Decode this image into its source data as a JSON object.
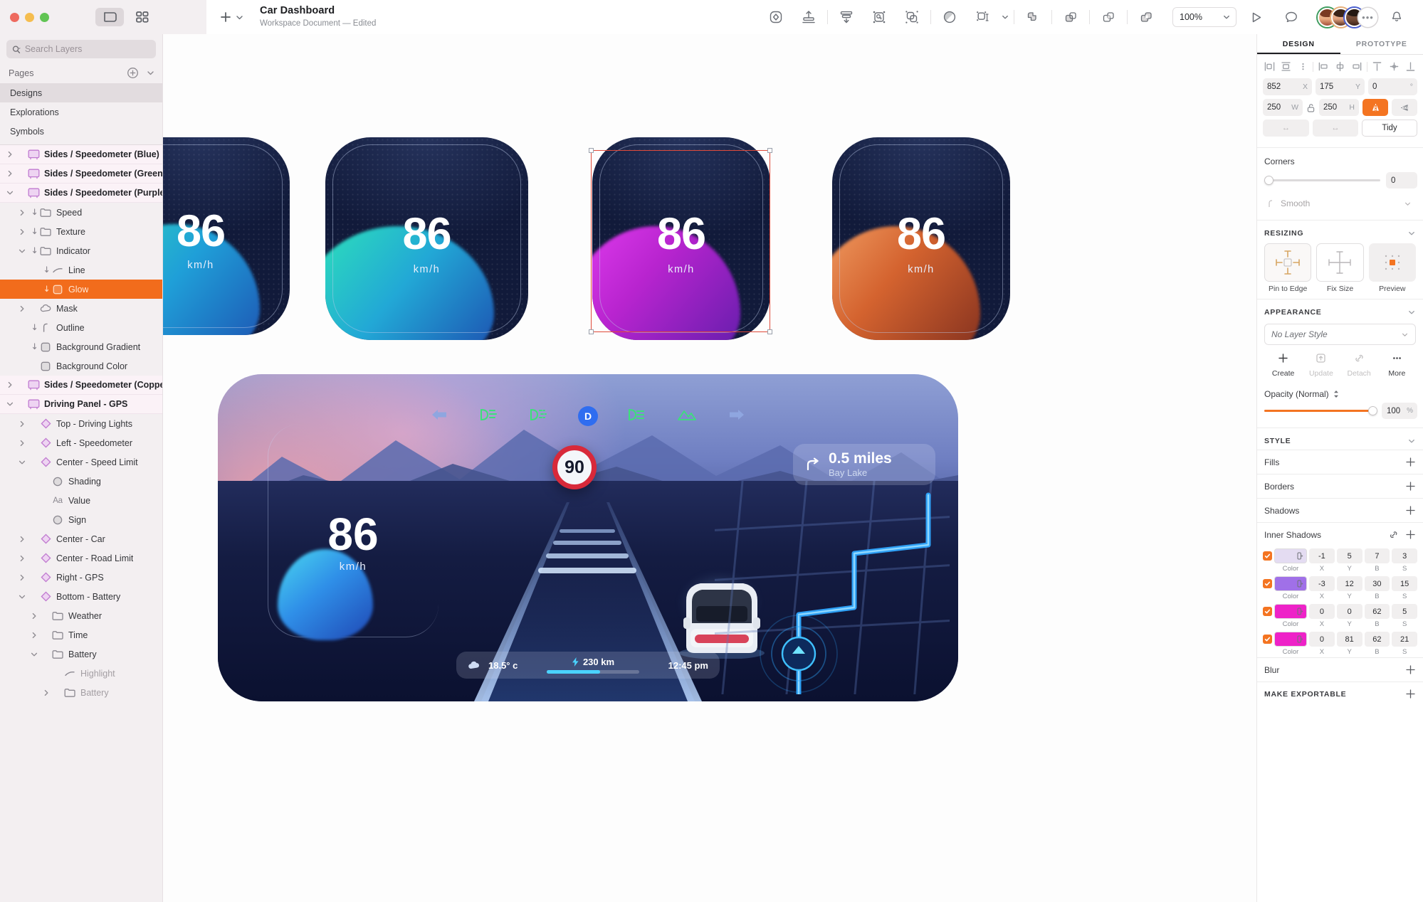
{
  "window": {
    "traffic_lights": [
      "close",
      "minimize",
      "maximize"
    ],
    "view_toggle_icons": [
      "canvas-view-icon",
      "grid-view-icon"
    ]
  },
  "toolbar": {
    "add_label": "+",
    "document_title": "Car Dashboard",
    "document_subtitle": "Workspace Document — Edited",
    "tools": [
      {
        "name": "component-icon",
        "label": "Component"
      },
      {
        "name": "align-vertical-icon",
        "label": "Align Vertical"
      },
      {
        "name": "distribute-icon",
        "label": "Distribute"
      },
      {
        "name": "group-icon",
        "label": "Group"
      },
      {
        "name": "ungroup-icon",
        "label": "Ungroup"
      },
      {
        "name": "mask-icon",
        "label": "Mask"
      },
      {
        "name": "scale-icon",
        "label": "Scale"
      },
      {
        "name": "boolean-union-icon",
        "label": "Union"
      },
      {
        "name": "boolean-subtract-icon",
        "label": "Subtract"
      },
      {
        "name": "boolean-intersect-icon",
        "label": "Intersect"
      },
      {
        "name": "boolean-difference-icon",
        "label": "Difference"
      }
    ],
    "zoom_value": "100%",
    "play_icon": "play-icon",
    "comment_icon": "comment-icon",
    "avatar_more": "•••",
    "bell_icon": "bell-icon"
  },
  "sidebar": {
    "search_placeholder": "Search Layers",
    "search_value": "",
    "pages_label": "Pages",
    "pages": [
      {
        "label": "Designs",
        "selected": true
      },
      {
        "label": "Explorations",
        "selected": false
      },
      {
        "label": "Symbols",
        "selected": false
      }
    ],
    "layers": [
      {
        "label": "Sides / Speedometer (Blue)",
        "kind": "artboard",
        "indent": 0,
        "disclosure": "collapsed",
        "selected": false
      },
      {
        "label": "Sides / Speedometer (Green)",
        "kind": "artboard",
        "indent": 0,
        "disclosure": "collapsed",
        "selected": false
      },
      {
        "label": "Sides / Speedometer (Purple)",
        "kind": "artboard",
        "indent": 0,
        "disclosure": "expanded",
        "selected": false
      },
      {
        "label": "Speed",
        "kind": "folder",
        "indent": 1,
        "disclosure": "collapsed",
        "mask": true,
        "selected": false
      },
      {
        "label": "Texture",
        "kind": "folder",
        "indent": 1,
        "disclosure": "collapsed",
        "mask": true,
        "selected": false
      },
      {
        "label": "Indicator",
        "kind": "folder",
        "indent": 1,
        "disclosure": "expanded",
        "mask": true,
        "selected": false
      },
      {
        "label": "Line",
        "kind": "line",
        "indent": 2,
        "disclosure": "none",
        "mask": true,
        "selected": false
      },
      {
        "label": "Glow",
        "kind": "shape",
        "indent": 2,
        "disclosure": "none",
        "mask": true,
        "selected": true
      },
      {
        "label": "Mask",
        "kind": "cloud",
        "indent": 1,
        "disclosure": "collapsed",
        "selected": false
      },
      {
        "label": "Outline",
        "kind": "outline",
        "indent": 1,
        "disclosure": "none",
        "mask": true,
        "selected": false
      },
      {
        "label": "Background Gradient",
        "kind": "shape",
        "indent": 1,
        "disclosure": "none",
        "mask": true,
        "selected": false
      },
      {
        "label": "Background Color",
        "kind": "shape",
        "indent": 1,
        "disclosure": "none",
        "selected": false
      },
      {
        "label": "Sides / Speedometer (Copper)",
        "kind": "artboard",
        "indent": 0,
        "disclosure": "collapsed",
        "selected": false
      },
      {
        "label": "Driving Panel - GPS",
        "kind": "artboard",
        "indent": 0,
        "disclosure": "expanded",
        "selected": false
      },
      {
        "label": "Top - Driving Lights",
        "kind": "symbol",
        "indent": 1,
        "disclosure": "collapsed",
        "selected": false
      },
      {
        "label": "Left - Speedometer",
        "kind": "symbol",
        "indent": 1,
        "disclosure": "collapsed",
        "selected": false
      },
      {
        "label": "Center - Speed Limit",
        "kind": "symbol",
        "indent": 1,
        "disclosure": "expanded",
        "selected": false
      },
      {
        "label": "Shading",
        "kind": "oval",
        "indent": 2,
        "disclosure": "none",
        "selected": false
      },
      {
        "label": "Value",
        "kind": "text",
        "indent": 2,
        "disclosure": "none",
        "selected": false
      },
      {
        "label": "Sign",
        "kind": "oval",
        "indent": 2,
        "disclosure": "none",
        "selected": false
      },
      {
        "label": "Center - Car",
        "kind": "symbol",
        "indent": 1,
        "disclosure": "collapsed",
        "selected": false
      },
      {
        "label": "Center - Road Limit",
        "kind": "symbol",
        "indent": 1,
        "disclosure": "collapsed",
        "selected": false
      },
      {
        "label": "Right - GPS",
        "kind": "symbol",
        "indent": 1,
        "disclosure": "collapsed",
        "selected": false
      },
      {
        "label": "Bottom - Battery",
        "kind": "symbol",
        "indent": 1,
        "disclosure": "expanded",
        "selected": false
      },
      {
        "label": "Weather",
        "kind": "folder",
        "indent": 2,
        "disclosure": "collapsed",
        "selected": false
      },
      {
        "label": "Time",
        "kind": "folder",
        "indent": 2,
        "disclosure": "collapsed",
        "selected": false
      },
      {
        "label": "Battery",
        "kind": "folder",
        "indent": 2,
        "disclosure": "expanded",
        "selected": false
      },
      {
        "label": "Highlight",
        "kind": "line",
        "indent": 3,
        "disclosure": "none",
        "dim": true,
        "selected": false
      },
      {
        "label": "Battery",
        "kind": "folder",
        "indent": 3,
        "disclosure": "collapsed",
        "dim": true,
        "selected": false
      }
    ]
  },
  "canvas": {
    "artboards": [
      {
        "name": "speedometer-blue",
        "speed": "86",
        "unit": "km/h",
        "accent": "#2fb6a8",
        "accent2": "#1c6fd0"
      },
      {
        "name": "speedometer-green",
        "speed": "86",
        "unit": "km/h",
        "accent": "#27d6a3",
        "accent2": "#1b8fd6"
      },
      {
        "name": "speedometer-purple",
        "speed": "86",
        "unit": "km/h",
        "accent": "#c724d9",
        "accent2": "#7a18b8",
        "selected": true
      },
      {
        "name": "speedometer-copper",
        "speed": "86",
        "unit": "km/h",
        "accent": "#e8834a",
        "accent2": "#a8492a"
      }
    ],
    "driving_panel": {
      "speed": "86",
      "speed_unit": "km/h",
      "speed_limit": "90",
      "nav_distance": "0.5 miles",
      "nav_place": "Bay Lake",
      "nav_arrow_icon": "turn-right-icon",
      "gear": "D",
      "temperature": "18.5° c",
      "weather_icon": "cloud-icon",
      "range": "230 km",
      "range_icon": "bolt-icon",
      "time": "12:45 pm",
      "left_arrow_icon": "turn-signal-left-icon",
      "right_arrow_icon": "turn-signal-right-icon",
      "indicator_icons": [
        "low-beam-icon",
        "fog-light-icon",
        "gear-d-icon",
        "high-beam-icon",
        "mountain-road-icon"
      ]
    }
  },
  "inspector": {
    "tabs": [
      {
        "label": "DESIGN",
        "active": true
      },
      {
        "label": "PROTOTYPE",
        "active": false
      }
    ],
    "align_icons": [
      "align-left-icon",
      "align-center-horizontal-icon",
      "align-more-icon",
      "distribute-left-icon",
      "distribute-center-icon",
      "distribute-right-icon",
      "align-top-icon",
      "align-middle-icon",
      "align-bottom-icon"
    ],
    "geometry": {
      "x_value": "852",
      "x_label": "X",
      "y_value": "175",
      "y_label": "Y",
      "rotation_value": "0",
      "rotation_label": "°",
      "w_value": "250",
      "w_label": "W",
      "h_value": "250",
      "h_label": "H",
      "lock_icon": "unlock-icon",
      "flip_h_icon": "flip-horizontal-icon",
      "flip_v_icon": "flip-vertical-icon",
      "tidy_label": "Tidy"
    },
    "corners": {
      "title": "Corners",
      "radius_value": "0",
      "smooth_label": "Smooth"
    },
    "resizing": {
      "title": "RESIZING",
      "options": [
        {
          "label": "Pin to Edge",
          "name": "pin-to-edge-option",
          "selected": true
        },
        {
          "label": "Fix Size",
          "name": "fix-size-option",
          "selected": false
        },
        {
          "label": "Preview",
          "name": "resize-preview",
          "selected": false
        }
      ]
    },
    "appearance": {
      "title": "APPEARANCE",
      "layer_style": "No Layer Style",
      "actions": [
        {
          "label": "Create",
          "icon": "plus-icon",
          "disabled": false
        },
        {
          "label": "Update",
          "icon": "update-icon",
          "disabled": true
        },
        {
          "label": "Detach",
          "icon": "detach-icon",
          "disabled": true
        },
        {
          "label": "More",
          "icon": "more-icon",
          "disabled": false
        }
      ],
      "opacity_label": "Opacity (Normal)",
      "opacity_value": "100",
      "opacity_unit": "%"
    },
    "style": {
      "title": "STYLE",
      "rows": [
        {
          "label": "Fills",
          "add": "+"
        },
        {
          "label": "Borders",
          "add": "+"
        },
        {
          "label": "Shadows",
          "add": "+"
        }
      ],
      "inner_shadows": {
        "label": "Inner Shadows",
        "link_icon": "link-icon",
        "add": "+",
        "columns": [
          "Color",
          "X",
          "Y",
          "B",
          "S"
        ],
        "items": [
          {
            "enabled": true,
            "color": "#e4dcf2",
            "x": "-1",
            "y": "5",
            "b": "7",
            "s": "3"
          },
          {
            "enabled": true,
            "color": "#a070e8",
            "x": "-3",
            "y": "12",
            "b": "30",
            "s": "15"
          },
          {
            "enabled": true,
            "color": "#ee22c8",
            "x": "0",
            "y": "0",
            "b": "62",
            "s": "5"
          },
          {
            "enabled": true,
            "color": "#ee22c8",
            "x": "0",
            "y": "81",
            "b": "62",
            "s": "21"
          }
        ]
      },
      "blur": {
        "label": "Blur",
        "add": "+"
      },
      "export": {
        "label": "MAKE EXPORTABLE",
        "add": "+"
      }
    }
  }
}
